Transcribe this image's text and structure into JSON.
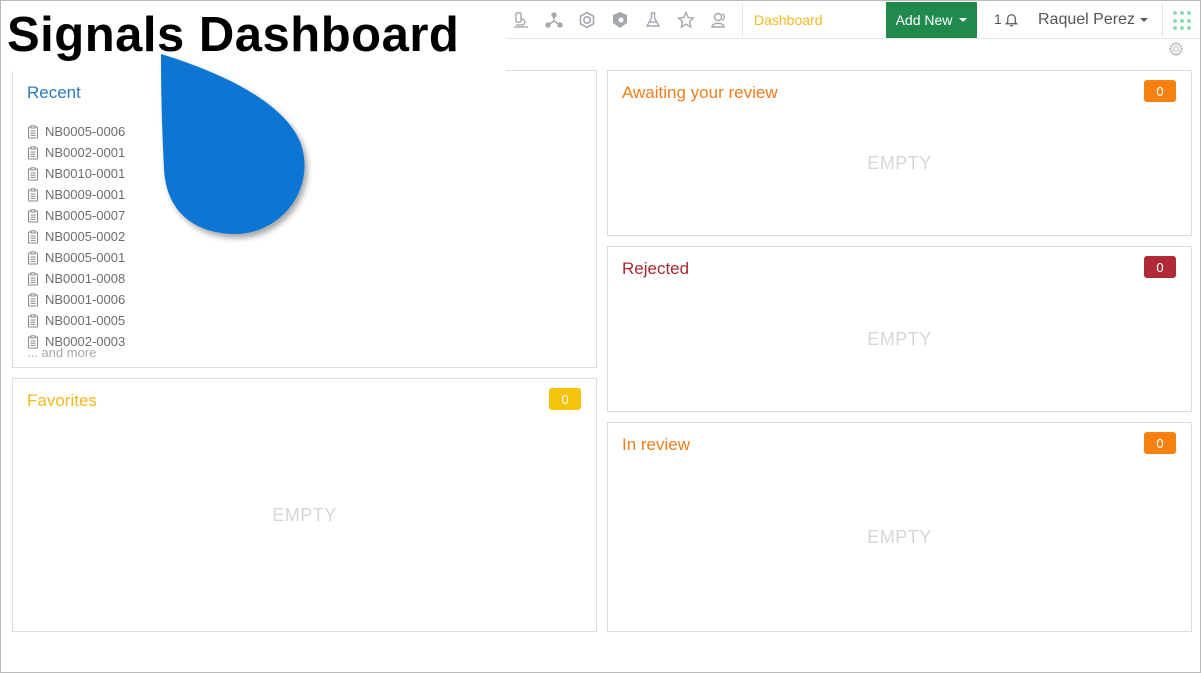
{
  "overlay_title": "Signals Dashboard",
  "navbar": {
    "icons": [
      "microscope-icon",
      "molecule-network-icon",
      "chemical-ring-icon",
      "shield-icon",
      "flask-icon",
      "star-icon",
      "users-icon"
    ],
    "dashboard_label": "Dashboard",
    "add_new_label": "Add New",
    "notifications_count": "1",
    "user_name": "Raquel Perez"
  },
  "panels": {
    "recent": {
      "title": "Recent",
      "items": [
        "NB0005-0006",
        "NB0002-0001",
        "NB0010-0001",
        "NB0009-0001",
        "NB0005-0007",
        "NB0005-0002",
        "NB0005-0001",
        "NB0001-0008",
        "NB0001-0006",
        "NB0001-0005",
        "NB0002-0003"
      ],
      "more_label": "... and more"
    },
    "favorites": {
      "title": "Favorites",
      "count": "0",
      "empty_label": "EMPTY"
    },
    "awaiting_review": {
      "title": "Awaiting your review",
      "count": "0",
      "empty_label": "EMPTY"
    },
    "rejected": {
      "title": "Rejected",
      "count": "0",
      "empty_label": "EMPTY"
    },
    "in_review": {
      "title": "In review",
      "count": "0",
      "empty_label": "EMPTY"
    }
  },
  "colors": {
    "recent_title": "#2a7ac0",
    "favorites_title": "#f5b822",
    "favorites_badge": "#f5c30a",
    "awaiting_title": "#f07d1c",
    "awaiting_badge": "#f7810f",
    "rejected_title": "#a52a33",
    "rejected_badge": "#b02a37",
    "in_review_title": "#f07d1c",
    "in_review_badge": "#f7810f",
    "add_new": "#1f8a4c",
    "logo_blue": "#0a76d4"
  }
}
